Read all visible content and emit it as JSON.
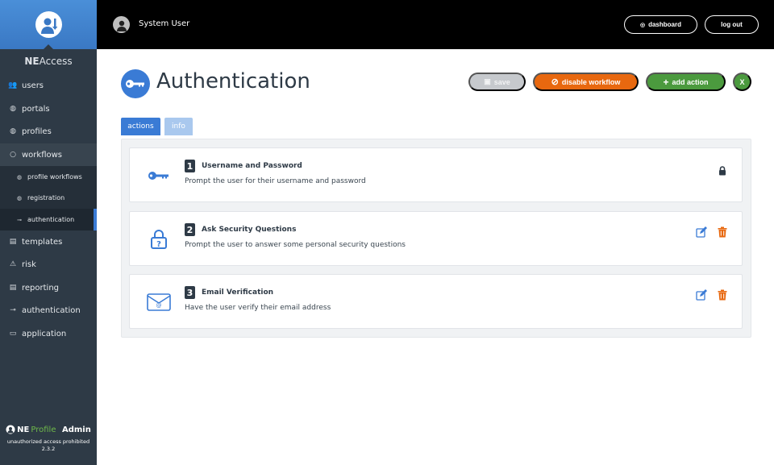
{
  "app": {
    "brand": {
      "bold": "NE",
      "rest": "Access",
      "mark": "·"
    },
    "logo_icon": "user-key-logo-icon"
  },
  "topbar": {
    "user_name": "System User",
    "dashboard_label": "dashboard",
    "logout_label": "log out"
  },
  "sidebar": {
    "items": [
      {
        "label": "users",
        "icon": "users-icon"
      },
      {
        "label": "portals",
        "icon": "globe-icon"
      },
      {
        "label": "profiles",
        "icon": "globe-icon"
      },
      {
        "label": "workflows",
        "icon": "circle-icon"
      },
      {
        "label": "profile workflows",
        "icon": "globe-icon"
      },
      {
        "label": "registration",
        "icon": "globe-icon"
      },
      {
        "label": "authentication",
        "icon": "key-icon"
      },
      {
        "label": "templates",
        "icon": "document-icon"
      },
      {
        "label": "risk",
        "icon": "warning-icon"
      },
      {
        "label": "reporting",
        "icon": "report-icon"
      },
      {
        "label": "authentication",
        "icon": "key-icon"
      },
      {
        "label": "application",
        "icon": "monitor-icon"
      }
    ],
    "footer": {
      "product_ne": "NE",
      "product_profile": "Profile",
      "product_admin": "Admin",
      "warning": "unauthorized access prohibited",
      "version": "2.3.2"
    }
  },
  "page": {
    "title": "Authentication",
    "buttons": {
      "save": "save",
      "disable": "disable workflow",
      "add": "add action",
      "close": "X"
    },
    "tabs": [
      {
        "label": "actions",
        "active": true
      },
      {
        "label": "info",
        "active": false
      }
    ],
    "actions": [
      {
        "number": "1",
        "title": "Username and Password",
        "description": "Prompt the user for their username and password",
        "icon": "key-icon",
        "locked": true
      },
      {
        "number": "2",
        "title": "Ask Security Questions",
        "description": "Prompt the user to answer some personal security questions",
        "icon": "lock-question-icon",
        "locked": false
      },
      {
        "number": "3",
        "title": "Email Verification",
        "description": "Have the user verify their email address",
        "icon": "email-icon",
        "locked": false
      }
    ]
  },
  "colors": {
    "primary": "#3a7bd5",
    "orange": "#e8680f",
    "green": "#4b9a3e",
    "sidebar": "#2e3a46"
  }
}
